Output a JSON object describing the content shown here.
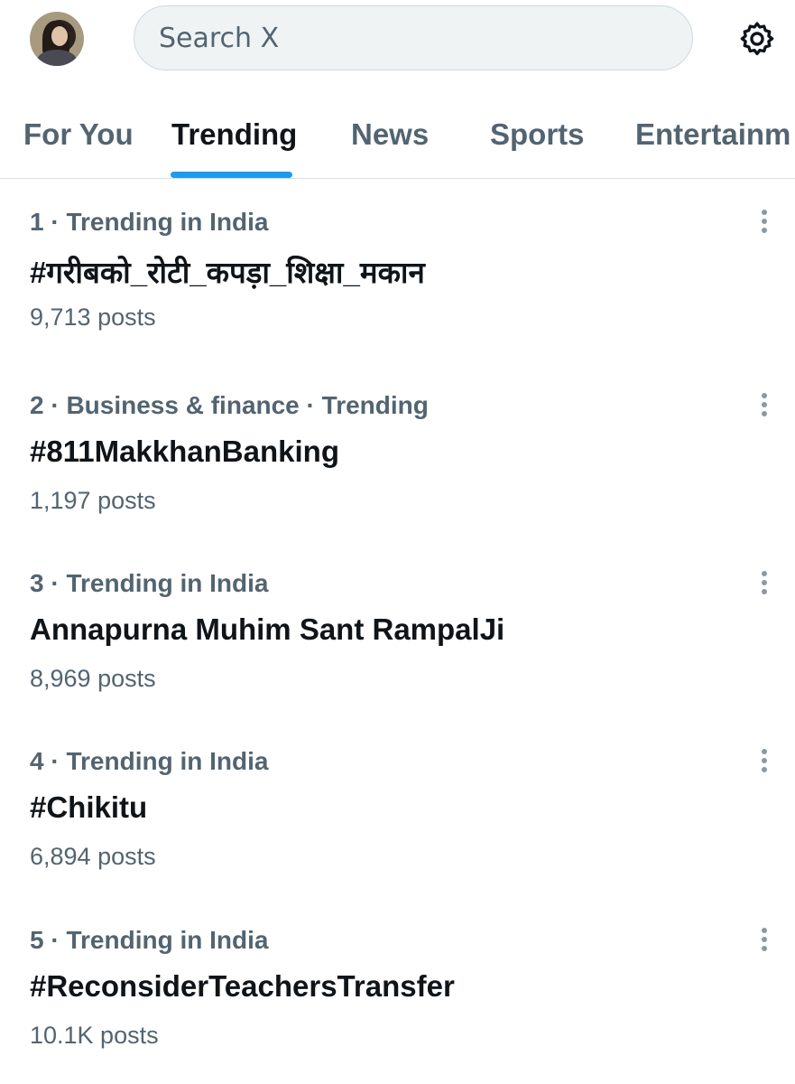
{
  "search": {
    "placeholder": "Search X"
  },
  "tabs": [
    {
      "label": "For You"
    },
    {
      "label": "Trending"
    },
    {
      "label": "News"
    },
    {
      "label": "Sports"
    },
    {
      "label": "Entertainm"
    }
  ],
  "active_tab": "Trending",
  "trends": [
    {
      "meta": "1 · Trending in India",
      "title": "#गरीबको_रोटी_कपड़ा_शिक्षा_मकान",
      "posts": "9,713 posts"
    },
    {
      "meta": "2 · Business & finance · Trending",
      "title": "#811MakkhanBanking",
      "posts": "1,197 posts"
    },
    {
      "meta": "3 · Trending in India",
      "title": "Annapurna Muhim Sant RampalJi",
      "posts": "8,969 posts"
    },
    {
      "meta": "4 · Trending in India",
      "title": "#Chikitu",
      "posts": "6,894 posts"
    },
    {
      "meta": "5 · Trending in India",
      "title": "#ReconsiderTeachersTransfer",
      "posts": "10.1K posts"
    }
  ],
  "colors": {
    "accent": "#1d9bf0",
    "text_primary": "#0f1419",
    "text_secondary": "#536471",
    "search_bg": "#eff3f4"
  },
  "icons": {
    "avatar": "user-avatar",
    "settings": "gear-icon",
    "more": "more-vertical-icon"
  }
}
